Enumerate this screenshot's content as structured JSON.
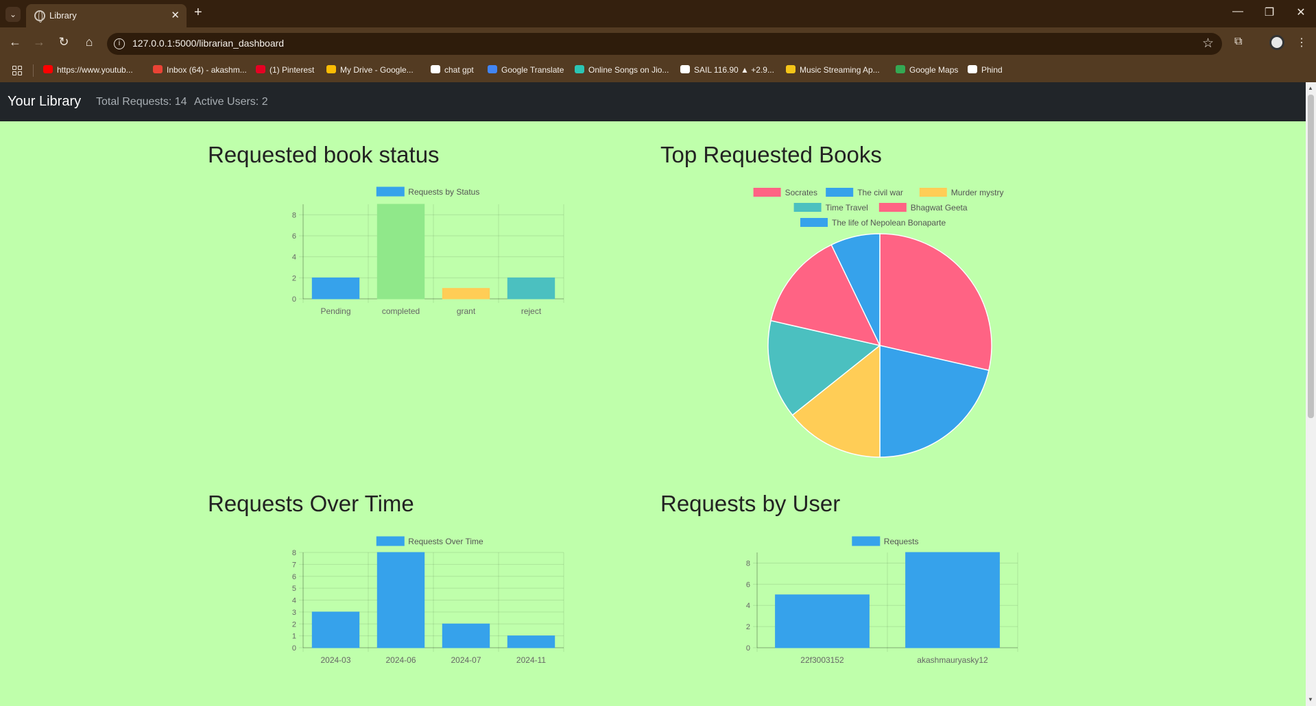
{
  "browser": {
    "tab_title": "Library",
    "url": "127.0.0.1:5000/librarian_dashboard",
    "bookmarks": [
      {
        "label": "https://www.youtub...",
        "color": "#ff0000"
      },
      {
        "label": "Inbox (64) - akashm...",
        "color": "#ea4335"
      },
      {
        "label": "(1) Pinterest",
        "color": "#e60023"
      },
      {
        "label": "My Drive - Google...",
        "color": "#fbbc04"
      },
      {
        "label": "chat gpt",
        "color": "#ffffff"
      },
      {
        "label": "Google Translate",
        "color": "#4285f4"
      },
      {
        "label": "Online Songs on Jio...",
        "color": "#2bc5b4"
      },
      {
        "label": "SAIL 116.90 ▲ +2.9...",
        "color": "#ffffff"
      },
      {
        "label": "Music Streaming Ap...",
        "color": "#f5c518"
      },
      {
        "label": "Google Maps",
        "color": "#34a853"
      },
      {
        "label": "Phind",
        "color": "#ffffff"
      }
    ]
  },
  "nav": {
    "brand": "Your Library",
    "total_requests": "Total Requests: 14",
    "active_users": "Active Users: 2"
  },
  "sections": {
    "status_title": "Requested book status",
    "top_books_title": "Top Requested Books",
    "over_time_title": "Requests Over Time",
    "by_user_title": "Requests by User"
  },
  "colors": {
    "blue": "#36a2eb",
    "green": "#90e88a",
    "yellow": "#ffcd56",
    "teal": "#4bc0c0",
    "pink": "#ff6384"
  },
  "chart_data": [
    {
      "type": "bar",
      "id": "status",
      "legend": "Requests by Status",
      "categories": [
        "Pending",
        "completed",
        "grant",
        "reject"
      ],
      "values": [
        2,
        9,
        1,
        2
      ],
      "colors": [
        "#36a2eb",
        "#90e88a",
        "#ffcd56",
        "#4bc0c0"
      ],
      "yticks": [
        0,
        2,
        4,
        6,
        8
      ],
      "ylim": [
        0,
        9
      ]
    },
    {
      "type": "pie",
      "id": "top_books",
      "labels": [
        "Socrates",
        "The civil war",
        "Murder mystry",
        "Time Travel",
        "Bhagwat Geeta",
        "The life of Nepolean Bonaparte"
      ],
      "values": [
        4,
        3,
        2,
        2,
        2,
        1
      ],
      "colors": [
        "#ff6384",
        "#36a2eb",
        "#ffcd56",
        "#4bc0c0",
        "#ff6384",
        "#36a2eb"
      ]
    },
    {
      "type": "bar",
      "id": "over_time",
      "legend": "Requests Over Time",
      "categories": [
        "2024-03",
        "2024-06",
        "2024-07",
        "2024-11"
      ],
      "values": [
        3,
        8,
        2,
        1
      ],
      "colors": [
        "#36a2eb",
        "#36a2eb",
        "#36a2eb",
        "#36a2eb"
      ],
      "yticks": [
        0,
        1,
        2,
        3,
        4,
        5,
        6,
        7,
        8
      ],
      "ylim": [
        0,
        8
      ]
    },
    {
      "type": "bar",
      "id": "by_user",
      "legend": "Requests",
      "categories": [
        "22f3003152",
        "akashmauryasky12"
      ],
      "values": [
        5,
        9
      ],
      "colors": [
        "#36a2eb",
        "#36a2eb"
      ],
      "yticks": [
        0,
        2,
        4,
        6,
        8
      ],
      "ylim": [
        0,
        9
      ]
    }
  ]
}
